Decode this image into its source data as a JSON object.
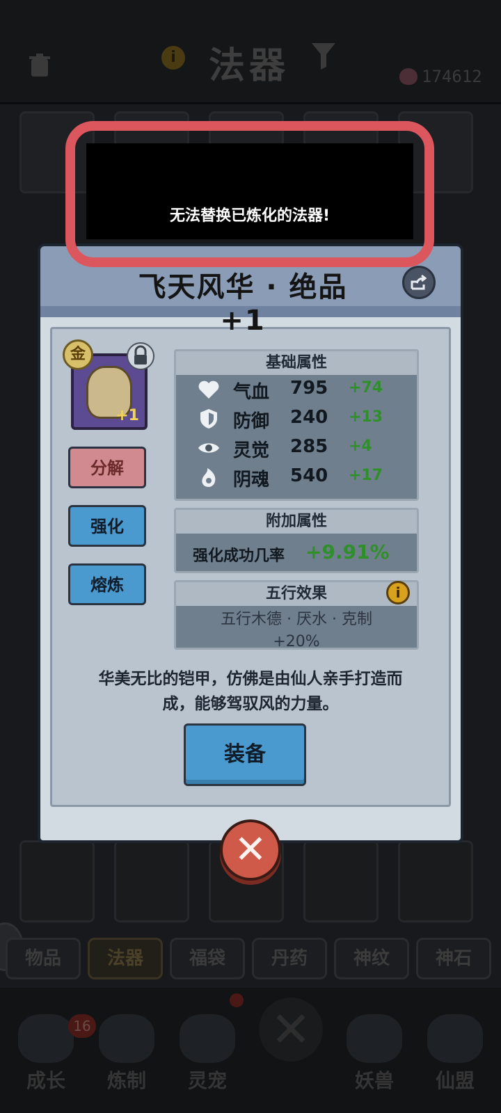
{
  "header": {
    "title": "法器",
    "currency_value": "174612"
  },
  "toast": {
    "message": "无法替换已炼化的法器!"
  },
  "item": {
    "name": "飞天风华 · 绝品 +1",
    "rank_badge": "金",
    "level_suffix": "+1"
  },
  "actions": {
    "disassemble": "分解",
    "enhance": "强化",
    "smelt": "熔炼",
    "equip": "装备"
  },
  "base_attributes": {
    "title": "基础属性",
    "rows": [
      {
        "icon": "heart-icon",
        "name": "气血",
        "value": "795",
        "bonus": "+74"
      },
      {
        "icon": "shield-icon",
        "name": "防御",
        "value": "240",
        "bonus": "+13"
      },
      {
        "icon": "eye-icon",
        "name": "灵觉",
        "value": "285",
        "bonus": "+4"
      },
      {
        "icon": "soul-flame-icon",
        "name": "阴魂",
        "value": "540",
        "bonus": "+17"
      }
    ]
  },
  "extra_attributes": {
    "title": "附加属性",
    "label": "强化成功几率",
    "value": "+9.91%"
  },
  "five_elements": {
    "title": "五行效果",
    "text_line1": "五行木德 · 厌水 · 克制",
    "text_line2": "+20%"
  },
  "description": {
    "line1": "华美无比的铠甲，仿佛是由仙人亲手打造而",
    "line2": "成，能够驾驭风的力量。"
  },
  "bottom_tabs": [
    "物品",
    "法器",
    "福袋",
    "丹药",
    "神纹",
    "神石"
  ],
  "nav": {
    "items": [
      "成长",
      "炼制",
      "灵宠",
      "妖兽",
      "仙盟"
    ],
    "growth_badge": "16"
  },
  "colors": {
    "highlight": "#dc565e",
    "bonus_green": "#2f8f2a",
    "button_blue": "#4a9ad0",
    "button_red": "#d18a8f"
  }
}
